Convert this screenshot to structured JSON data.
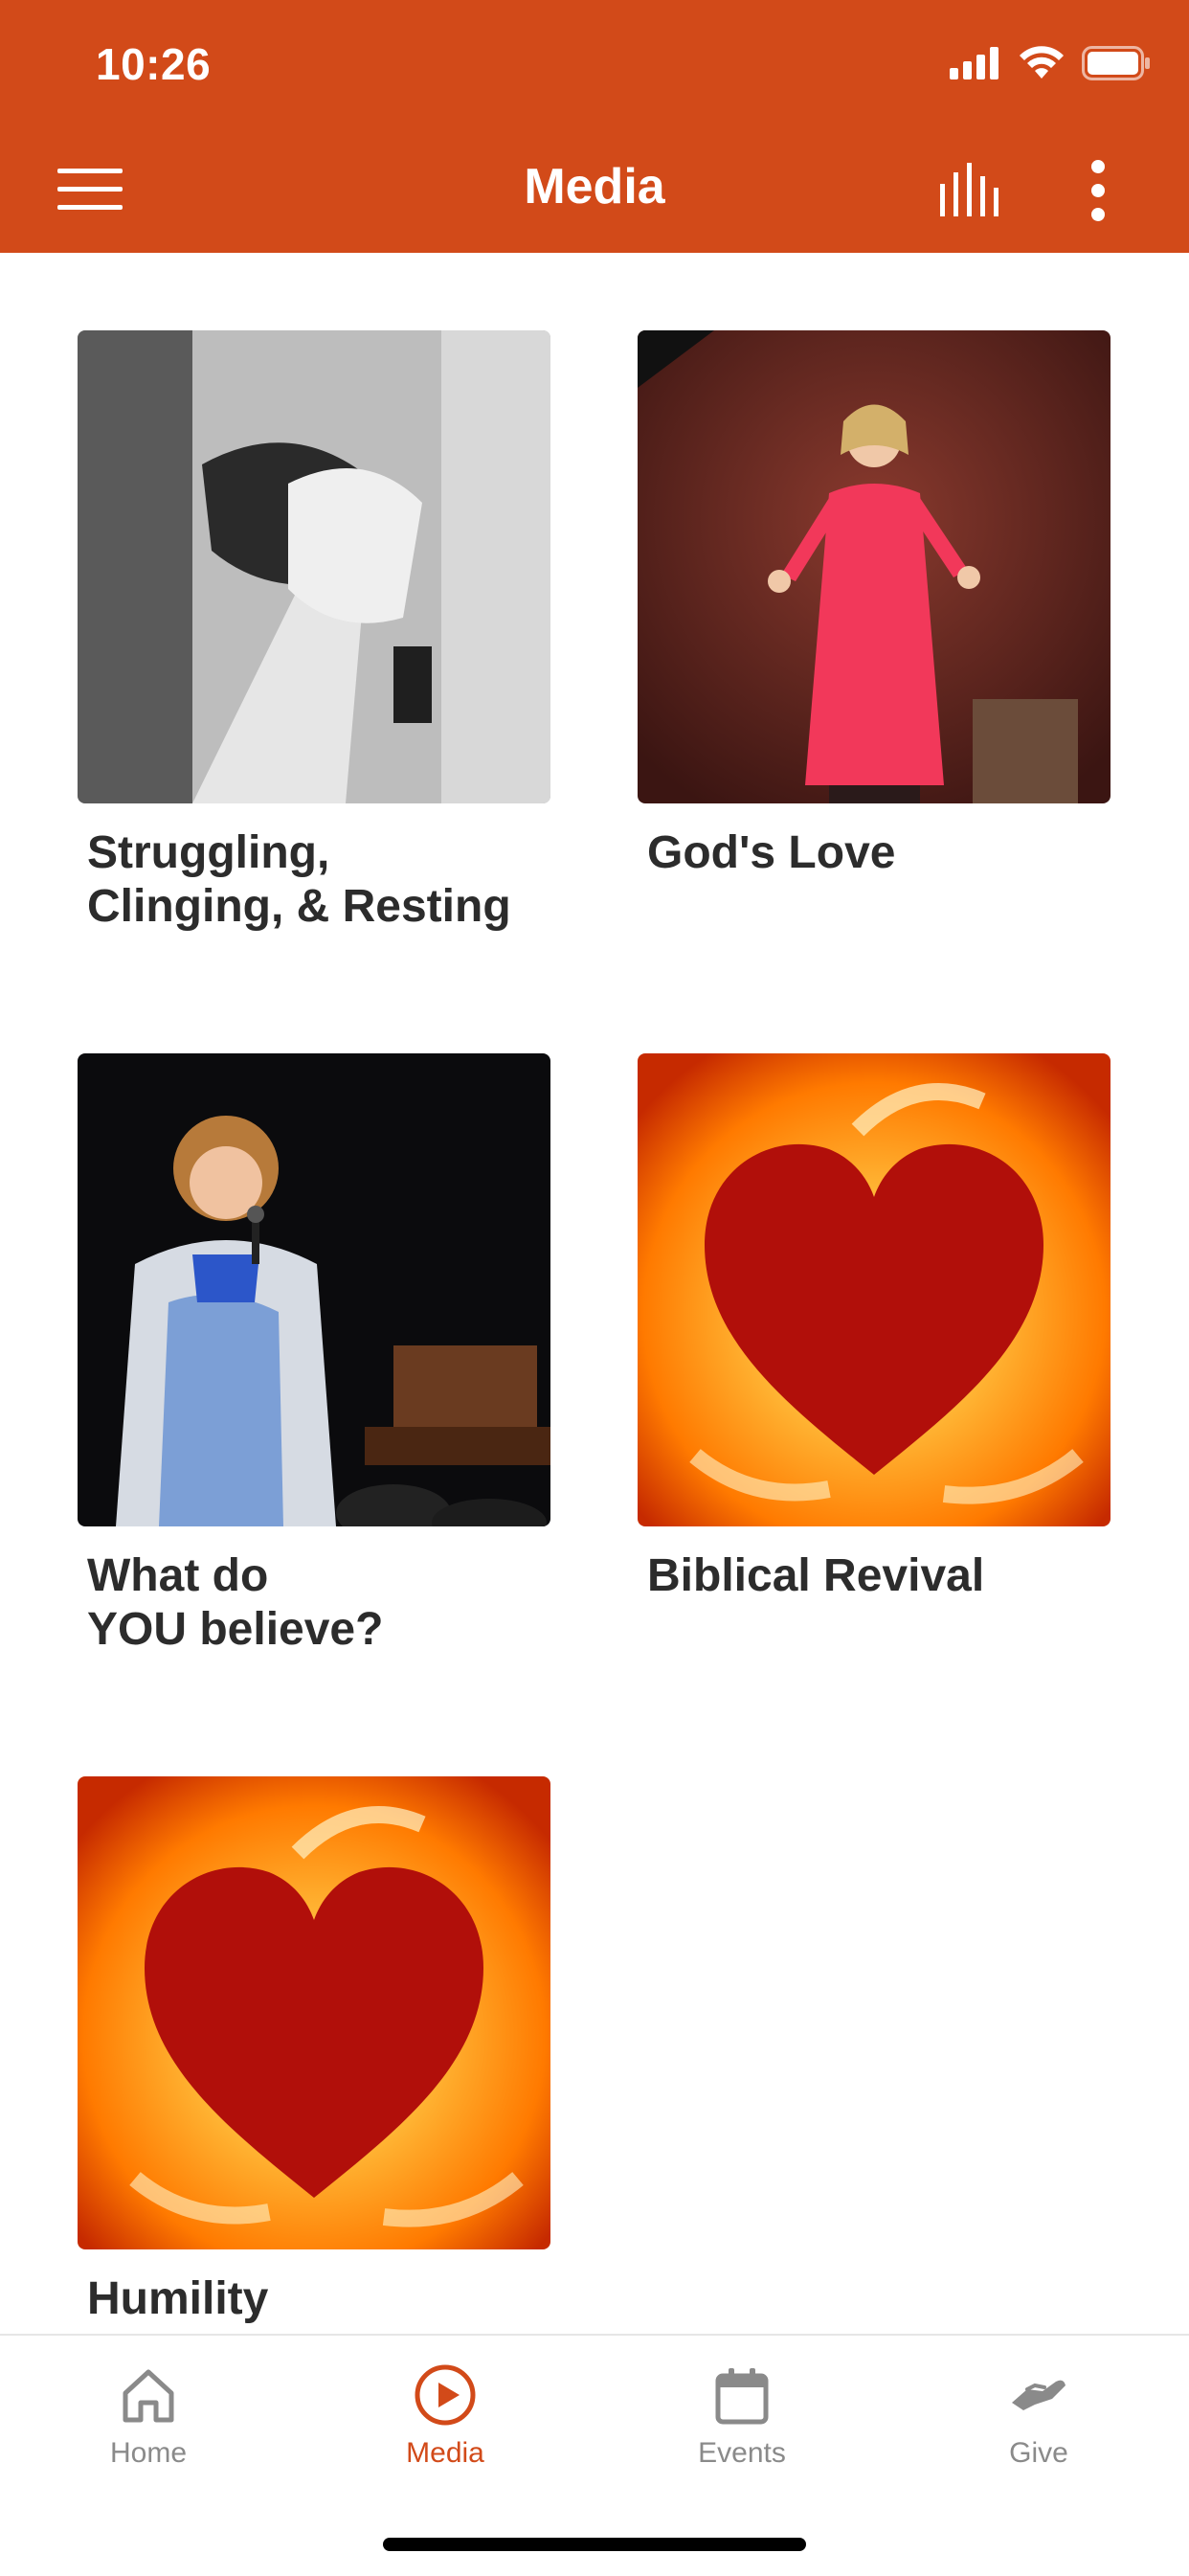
{
  "status_bar": {
    "time": "10:26"
  },
  "header": {
    "title": "Media",
    "menu_icon": "hamburger-icon",
    "bars_icon": "audio-bars-icon",
    "more_icon": "more-vertical-icon"
  },
  "media_items": [
    {
      "title": "Struggling,\nClinging, & Resting"
    },
    {
      "title": "God's Love"
    },
    {
      "title": "What do\nYOU believe?"
    },
    {
      "title": "Biblical Revival"
    },
    {
      "title": "Humility"
    }
  ],
  "bottom_nav": {
    "items": [
      {
        "label": "Home",
        "icon": "home-icon"
      },
      {
        "label": "Media",
        "icon": "play-circle-icon"
      },
      {
        "label": "Events",
        "icon": "calendar-icon"
      },
      {
        "label": "Give",
        "icon": "give-hand-icon"
      }
    ],
    "active_index": 1
  },
  "colors": {
    "accent": "#d24a19",
    "inactive": "#8a8a8a"
  }
}
